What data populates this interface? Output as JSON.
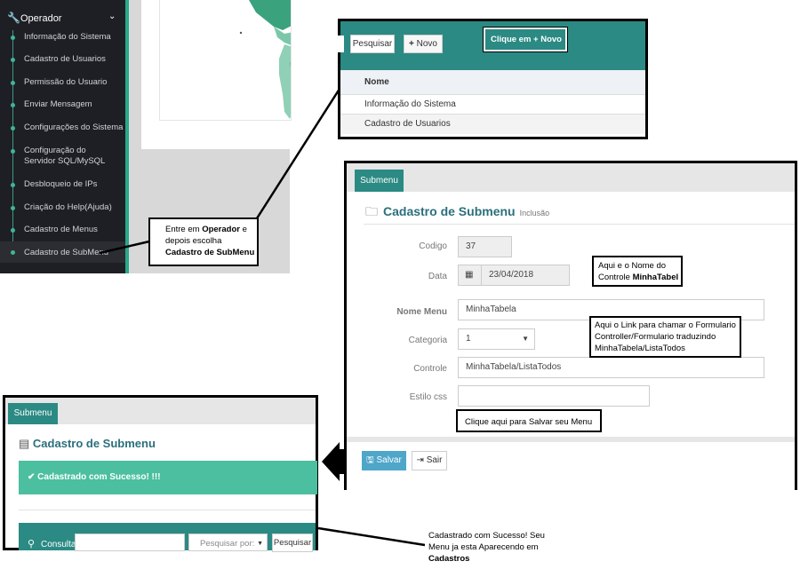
{
  "sidebar": {
    "header": "Operador",
    "items": [
      {
        "label": "Informação do Sistema"
      },
      {
        "label": "Cadastro de Usuarios"
      },
      {
        "label": "Permissão do Usuario"
      },
      {
        "label": "Enviar Mensagem"
      },
      {
        "label": "Configurações do Sistema"
      },
      {
        "label": "Configuração do Servidor SQL/MySQL"
      },
      {
        "label": "Desbloqueio de IPs"
      },
      {
        "label": "Criação do Help(Ajuda)"
      },
      {
        "label": "Cadastro de Menus"
      },
      {
        "label": "Cadastro de SubMenu"
      }
    ]
  },
  "panel_list": {
    "search_button": "Pesquisar",
    "new_button": "Novo",
    "column_header": "Nome",
    "rows": [
      "Informação do Sistema",
      "Cadastro de Usuarios"
    ]
  },
  "callouts": {
    "novo": "Clique em + Novo",
    "operador_prefix": "Entre em ",
    "operador_bold": "Operador",
    "operador_mid": " e depois escolha",
    "operador_target": "Cadastro de SubMenu",
    "nome_line1": "Aqui e o Nome do Controle ",
    "nome_bold": "MinhaTabel",
    "link_text": "Aqui o Link para chamar o Formulario Controller/Formulario traduzindo MinhaTabela/ListaTodos",
    "salvar": "Clique aqui para Salvar seu Menu",
    "final_line": "Cadastrado com Sucesso! Seu Menu ja esta Aparecendo em",
    "final_bold": "Cadastros"
  },
  "form": {
    "tab": "Submenu",
    "title": "Cadastro de Submenu",
    "subtitle": "Inclusão",
    "fields": {
      "codigo_label": "Codigo",
      "codigo_value": "37",
      "data_label": "Data",
      "data_value": "23/04/2018",
      "nome_label": "Nome Menu",
      "nome_value": "MinhaTabela",
      "categoria_label": "Categoria",
      "categoria_value": "1",
      "controle_label": "Controle",
      "controle_value": "MinhaTabela/ListaTodos",
      "estilo_label": "Estilo css",
      "estilo_value": ""
    },
    "save_button": "Salvar",
    "exit_button": "Sair"
  },
  "result": {
    "tab": "Submenu",
    "title": "Cadastro de Submenu",
    "alert": "Cadastrado com Sucesso! !!!",
    "consulta_label": "Consulta",
    "search_by_placeholder": "Pesquisar por:",
    "search_button": "Pesquisar"
  },
  "colors": {
    "teal": "#2b8a83",
    "alert_green": "#4bbf9f",
    "sidebar_bg": "#1e1f24",
    "map_green": "#3aa37e"
  }
}
